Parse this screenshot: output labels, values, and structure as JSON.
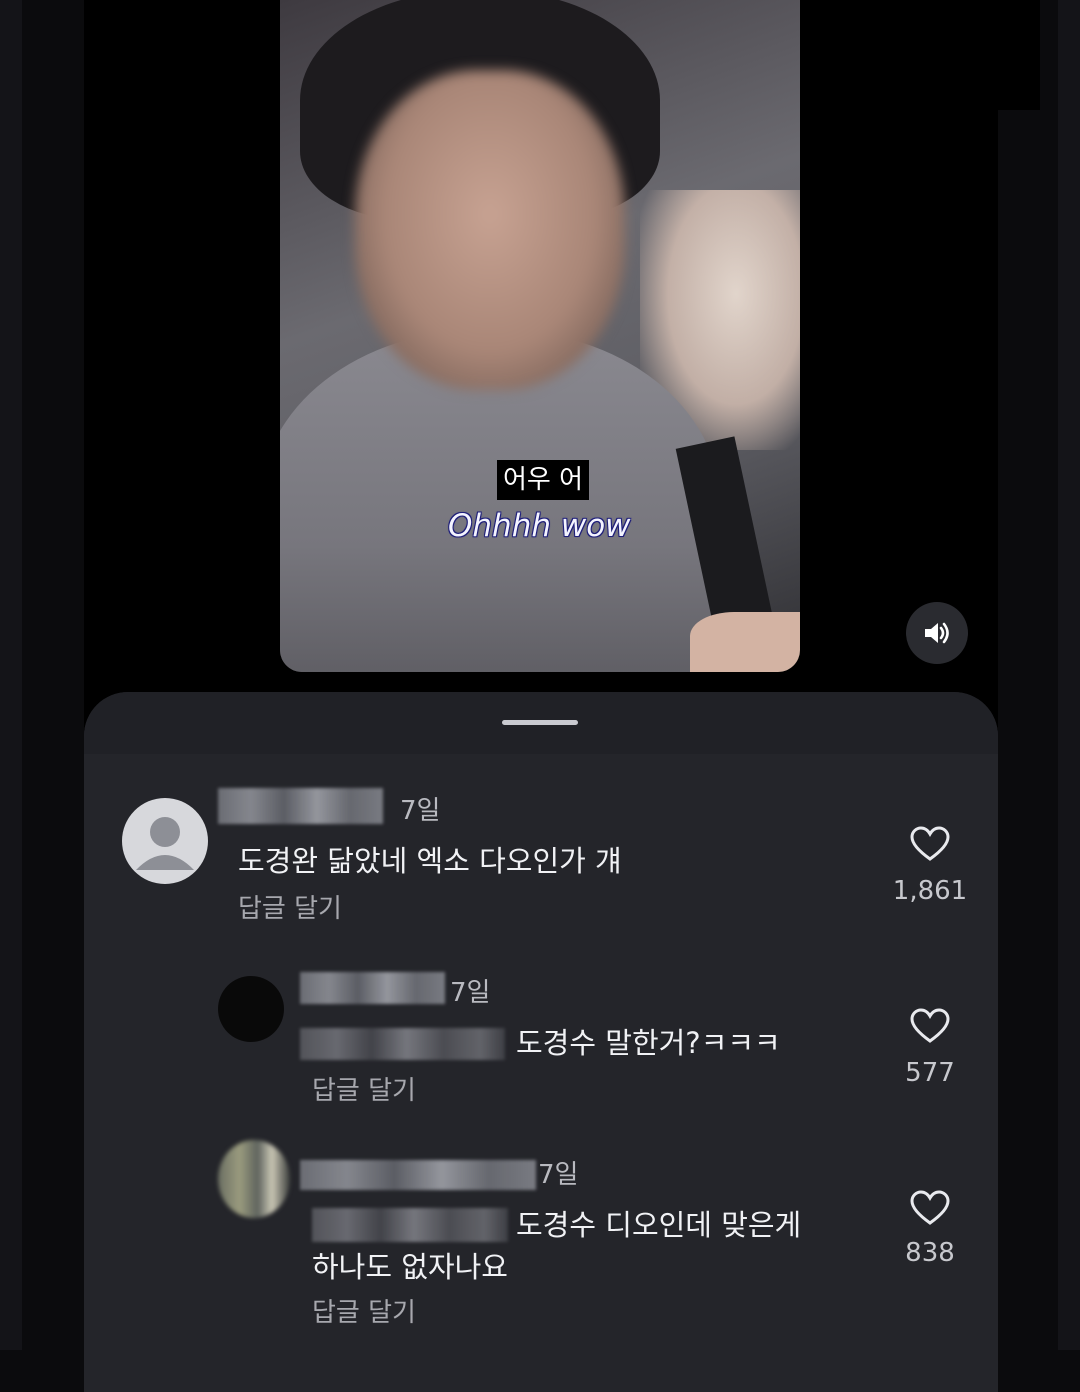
{
  "video": {
    "subtitle_ko": "어우 어",
    "subtitle_en": "Ohhhh wow",
    "sound_icon": "speaker-icon"
  },
  "comments": [
    {
      "time": "7일",
      "text": "도경완 닮았네 엑소 다오인가 걔",
      "reply_label": "답글 달기",
      "likes": "1,861"
    },
    {
      "time": "7일",
      "text": "도경수 말한거?ㅋㅋㅋ",
      "reply_label": "답글 달기",
      "likes": "577"
    },
    {
      "time": "7일",
      "text_line1": "도경수 디오인데 맞은게",
      "text_line2": "하나도 없자나요",
      "reply_label": "답글 달기",
      "likes": "838"
    }
  ],
  "icons": {
    "like": "heart-icon",
    "avatar": "default-avatar-icon"
  }
}
